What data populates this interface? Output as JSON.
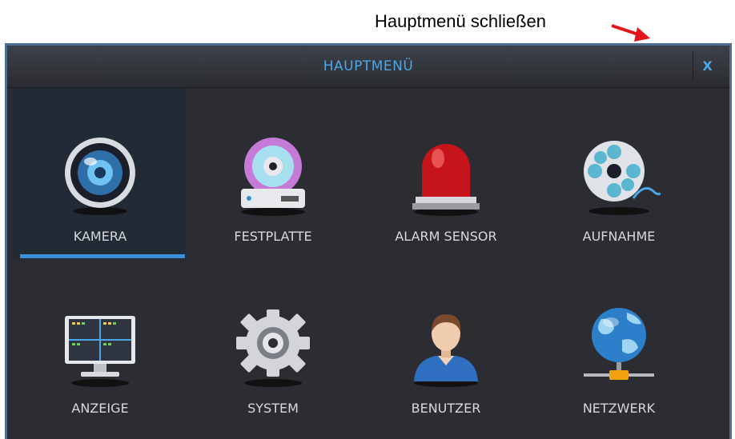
{
  "annotation": {
    "text": "Hauptmenü schließen"
  },
  "window": {
    "title": "HAUPTMENÜ",
    "close_label": "X"
  },
  "menu": {
    "items": [
      {
        "label": "KAMERA",
        "icon": "camera-lens-icon",
        "selected": true
      },
      {
        "label": "FESTPLATTE",
        "icon": "hard-disk-icon",
        "selected": false
      },
      {
        "label": "ALARM SENSOR",
        "icon": "alarm-siren-icon",
        "selected": false
      },
      {
        "label": "AUFNAHME",
        "icon": "film-reel-icon",
        "selected": false
      },
      {
        "label": "ANZEIGE",
        "icon": "monitor-icon",
        "selected": false
      },
      {
        "label": "SYSTEM",
        "icon": "gear-icon",
        "selected": false
      },
      {
        "label": "BENUTZER",
        "icon": "user-icon",
        "selected": false
      },
      {
        "label": "NETZWERK",
        "icon": "network-globe-icon",
        "selected": false
      }
    ]
  },
  "colors": {
    "accent": "#4aa7ea",
    "annotation": "#e8141b",
    "selected_bar": "#3c8fd6"
  }
}
